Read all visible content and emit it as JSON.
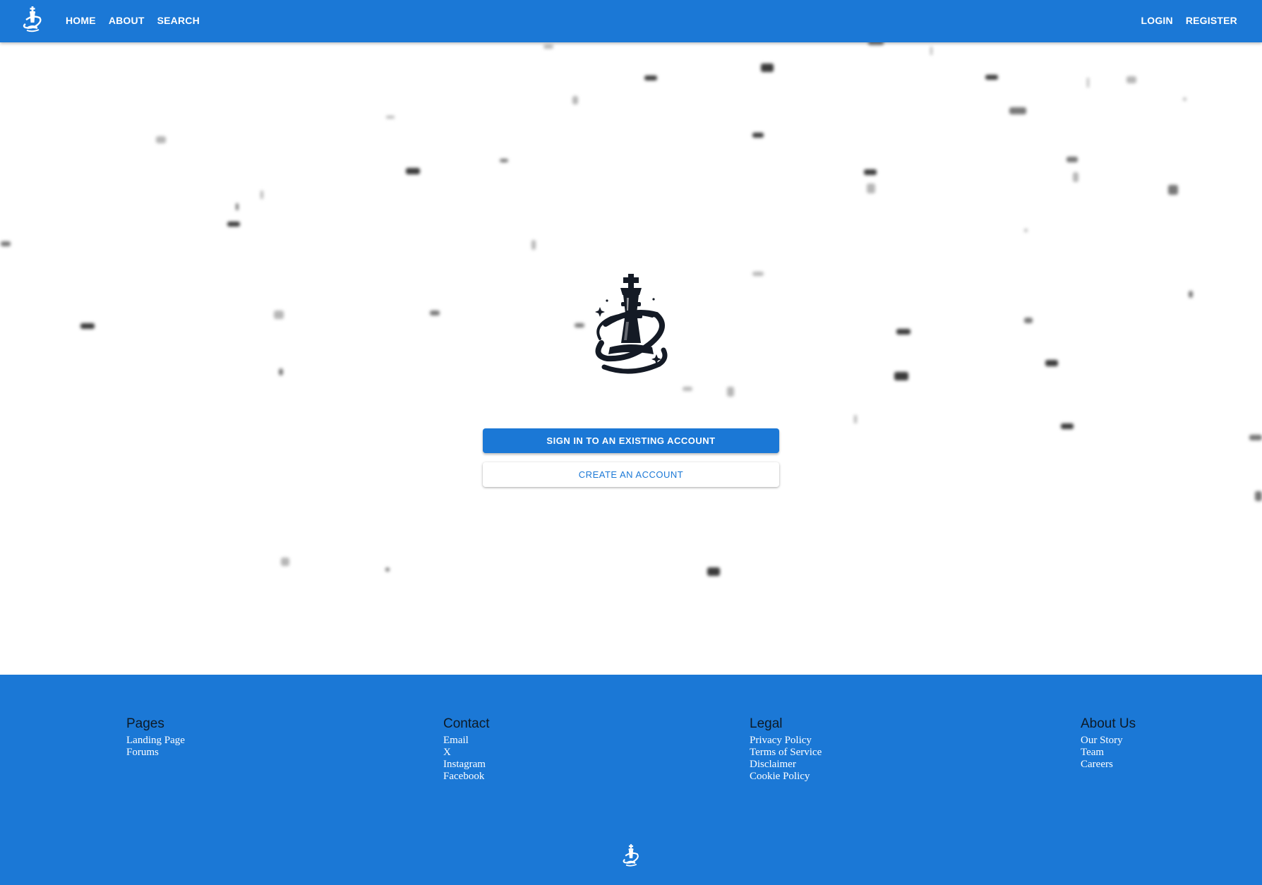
{
  "colors": {
    "primary": "#1b78d6",
    "background": "#ffffff",
    "footer_heading": "#0d1a26",
    "footer_link": "#ffffff"
  },
  "header": {
    "logo_icon": "chess-king-swirl-logo-icon",
    "nav_left": [
      "HOME",
      "ABOUT",
      "SEARCH"
    ],
    "nav_right": [
      "LOGIN",
      "REGISTER"
    ]
  },
  "main": {
    "logo_icon": "chess-king-swirl-logo-icon",
    "signin_label": "SIGN IN TO AN EXISTING ACCOUNT",
    "create_label": "CREATE AN ACCOUNT"
  },
  "footer": {
    "columns": [
      {
        "heading": "Pages",
        "links": [
          "Landing Page",
          "Forums"
        ]
      },
      {
        "heading": "Contact",
        "links": [
          "Email",
          "X",
          "Instagram",
          "Facebook"
        ]
      },
      {
        "heading": "Legal",
        "links": [
          "Privacy Policy",
          "Terms of Service",
          "Disclaimer",
          "Cookie Policy"
        ]
      },
      {
        "heading": "About Us",
        "links": [
          "Our Story",
          "Team",
          "Careers"
        ]
      }
    ],
    "logo_icon": "chess-king-swirl-logo-icon"
  }
}
